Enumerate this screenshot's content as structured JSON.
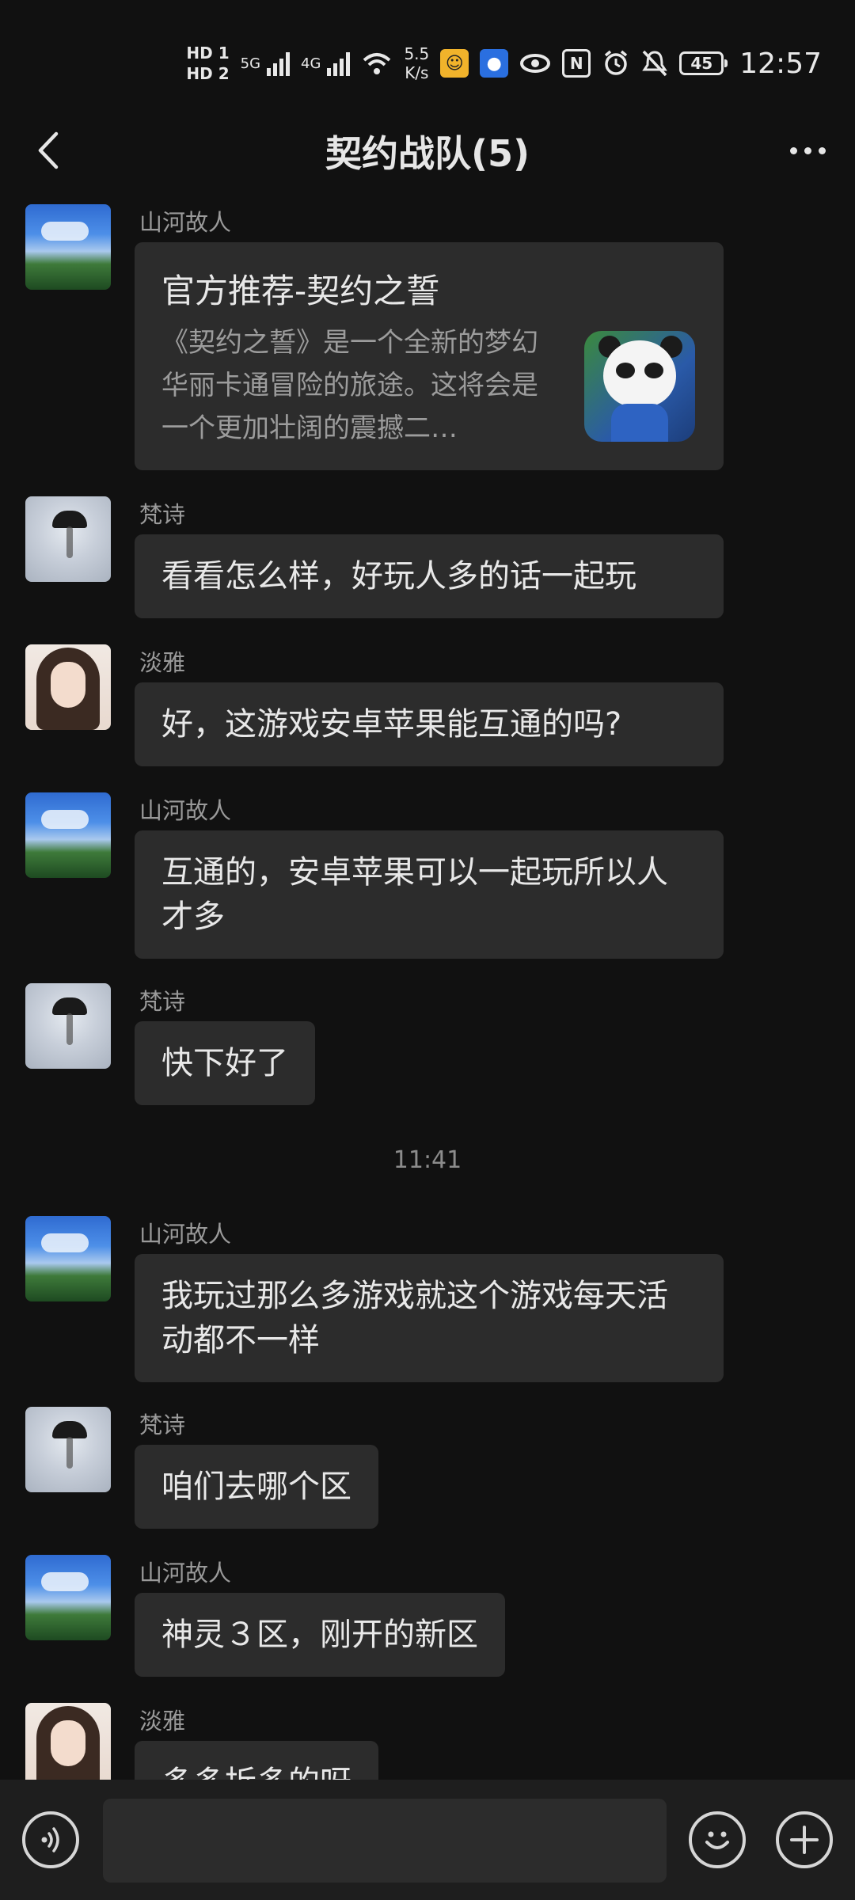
{
  "status_bar": {
    "hd1": "HD 1",
    "hd2": "HD 2",
    "net1": "5G",
    "net2": "4G",
    "speed_value": "5.5",
    "speed_unit": "K/s",
    "battery": "45",
    "time": "12:57"
  },
  "header": {
    "title": "契约战队(5)"
  },
  "messages": [
    {
      "sender": "山河故人",
      "avatar": "landscape-sky",
      "card": {
        "title": "官方推荐-契约之誓",
        "desc": "《契约之誓》是一个全新的梦幻华丽卡通冒险的旅途。这将会是一个更加壮阔的震撼二…"
      }
    },
    {
      "sender": "梵诗",
      "avatar": "mist-umbrella",
      "text": "看看怎么样，好玩人多的话一起玩"
    },
    {
      "sender": "淡雅",
      "avatar": "girl-portrait",
      "text": "好，这游戏安卓苹果能互通的吗?"
    },
    {
      "sender": "山河故人",
      "avatar": "landscape-sky",
      "text": "互通的，安卓苹果可以一起玩所以人才多"
    },
    {
      "sender": "梵诗",
      "avatar": "mist-umbrella",
      "text": "快下好了"
    },
    {
      "sender": "山河故人",
      "avatar": "landscape-sky",
      "text": "我玩过那么多游戏就这个游戏每天活动都不一样"
    },
    {
      "sender": "梵诗",
      "avatar": "mist-umbrella",
      "text": "咱们去哪个区"
    },
    {
      "sender": "山河故人",
      "avatar": "landscape-sky",
      "text": "神灵３区，刚开的新区"
    },
    {
      "sender": "淡雅",
      "avatar": "girl-portrait",
      "text": "多多拆多的呀"
    }
  ],
  "timestamp": "11:41",
  "composer": {
    "input_value": "",
    "voice_icon": "voice-icon",
    "emoji_icon": "emoji-icon",
    "plus_icon": "plus-icon"
  }
}
